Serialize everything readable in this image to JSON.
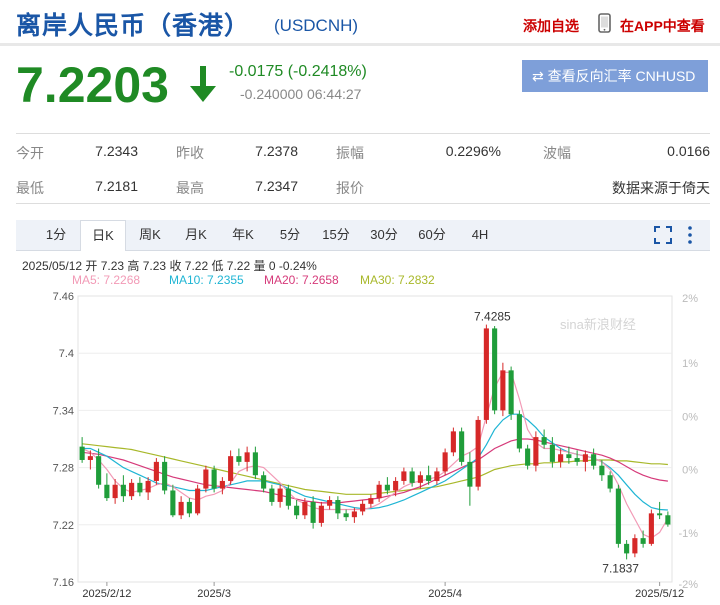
{
  "header": {
    "title": "离岸人民币（香港）",
    "symbol": "(USDCNH)",
    "add_watch": "添加自选",
    "app_link": "在APP中查看"
  },
  "quote": {
    "price": "7.2203",
    "change": "-0.0175 (-0.2418%)",
    "sub_change": "-0.240000 06:44:27",
    "reverse_button": "⇄ 查看反向汇率 CNHUSD"
  },
  "stats": {
    "row1": [
      {
        "label": "今开",
        "value": "7.2343"
      },
      {
        "label": "昨收",
        "value": "7.2378"
      },
      {
        "label": "振幅",
        "value": "0.2296%"
      },
      {
        "label": "波幅",
        "value": "0.0166"
      }
    ],
    "row2": [
      {
        "label": "最低",
        "value": "7.2181"
      },
      {
        "label": "最高",
        "value": "7.2347"
      },
      {
        "label": "报价",
        "value": "数据来源于倚天"
      }
    ]
  },
  "tabs": [
    "1分",
    "日K",
    "周K",
    "月K",
    "年K",
    "5分",
    "15分",
    "30分",
    "60分",
    "4H"
  ],
  "active_tab": "日K",
  "chart_info": {
    "line1": "2025/05/12 开 7.23 高 7.23 收 7.22 低 7.22 量 0 -0.24%",
    "ma5": "MA5: 7.2268",
    "ma10": "MA10: 7.2355",
    "ma20": "MA20: 7.2658",
    "ma30": "MA30: 7.2832"
  },
  "colors": {
    "up": "#d62828",
    "down": "#1f9d3a",
    "ma5": "#f29ab6",
    "ma10": "#1fb5d4",
    "ma20": "#d63a7a",
    "ma30": "#a8b82a"
  },
  "chart_data": {
    "type": "candlestick",
    "y_ticks": [
      "7.46",
      "7.4",
      "7.34",
      "7.28",
      "7.22",
      "7.16"
    ],
    "y_ticks_pct": [
      "2%",
      "1%",
      "0%",
      "0%",
      "-1%",
      "-2%"
    ],
    "x_ticks": [
      "2025/2/12",
      "2025/3",
      "2025/4",
      "2025/5/12"
    ],
    "annotations": [
      "7.4285",
      "7.1837"
    ],
    "watermark": "sina新浪财经",
    "ylim": [
      7.16,
      7.46
    ],
    "candles": [
      [
        7.302,
        7.312,
        7.285,
        7.288
      ],
      [
        7.288,
        7.298,
        7.278,
        7.292
      ],
      [
        7.292,
        7.3,
        7.258,
        7.262
      ],
      [
        7.262,
        7.274,
        7.245,
        7.248
      ],
      [
        7.248,
        7.268,
        7.242,
        7.262
      ],
      [
        7.262,
        7.272,
        7.244,
        7.25
      ],
      [
        7.25,
        7.268,
        7.246,
        7.264
      ],
      [
        7.264,
        7.27,
        7.25,
        7.254
      ],
      [
        7.254,
        7.27,
        7.246,
        7.266
      ],
      [
        7.266,
        7.29,
        7.262,
        7.286
      ],
      [
        7.286,
        7.292,
        7.252,
        7.256
      ],
      [
        7.256,
        7.262,
        7.228,
        7.23
      ],
      [
        7.23,
        7.25,
        7.226,
        7.244
      ],
      [
        7.244,
        7.248,
        7.228,
        7.232
      ],
      [
        7.232,
        7.262,
        7.23,
        7.258
      ],
      [
        7.258,
        7.282,
        7.254,
        7.278
      ],
      [
        7.278,
        7.282,
        7.254,
        7.258
      ],
      [
        7.258,
        7.27,
        7.252,
        7.266
      ],
      [
        7.266,
        7.298,
        7.262,
        7.292
      ],
      [
        7.292,
        7.3,
        7.282,
        7.286
      ],
      [
        7.286,
        7.302,
        7.276,
        7.296
      ],
      [
        7.296,
        7.302,
        7.268,
        7.272
      ],
      [
        7.272,
        7.276,
        7.254,
        7.258
      ],
      [
        7.258,
        7.262,
        7.24,
        7.244
      ],
      [
        7.244,
        7.262,
        7.238,
        7.258
      ],
      [
        7.258,
        7.262,
        7.236,
        7.24
      ],
      [
        7.24,
        7.246,
        7.226,
        7.23
      ],
      [
        7.23,
        7.248,
        7.226,
        7.244
      ],
      [
        7.244,
        7.25,
        7.216,
        7.222
      ],
      [
        7.222,
        7.244,
        7.218,
        7.24
      ],
      [
        7.24,
        7.25,
        7.236,
        7.246
      ],
      [
        7.246,
        7.25,
        7.226,
        7.232
      ],
      [
        7.232,
        7.236,
        7.224,
        7.228
      ],
      [
        7.228,
        7.238,
        7.222,
        7.234
      ],
      [
        7.234,
        7.246,
        7.23,
        7.242
      ],
      [
        7.242,
        7.252,
        7.238,
        7.248
      ],
      [
        7.248,
        7.266,
        7.244,
        7.262
      ],
      [
        7.262,
        7.27,
        7.252,
        7.256
      ],
      [
        7.256,
        7.27,
        7.25,
        7.266
      ],
      [
        7.266,
        7.28,
        7.262,
        7.276
      ],
      [
        7.276,
        7.28,
        7.26,
        7.264
      ],
      [
        7.264,
        7.276,
        7.258,
        7.272
      ],
      [
        7.272,
        7.282,
        7.262,
        7.266
      ],
      [
        7.266,
        7.28,
        7.262,
        7.276
      ],
      [
        7.276,
        7.3,
        7.272,
        7.296
      ],
      [
        7.296,
        7.322,
        7.292,
        7.318
      ],
      [
        7.318,
        7.322,
        7.282,
        7.286
      ],
      [
        7.286,
        7.296,
        7.24,
        7.26
      ],
      [
        7.26,
        7.334,
        7.256,
        7.33
      ],
      [
        7.33,
        7.43,
        7.326,
        7.426
      ],
      [
        7.426,
        7.4285,
        7.336,
        7.34
      ],
      [
        7.34,
        7.39,
        7.334,
        7.382
      ],
      [
        7.382,
        7.386,
        7.33,
        7.336
      ],
      [
        7.336,
        7.34,
        7.296,
        7.3
      ],
      [
        7.3,
        7.304,
        7.278,
        7.282
      ],
      [
        7.282,
        7.318,
        7.276,
        7.312
      ],
      [
        7.312,
        7.32,
        7.3,
        7.304
      ],
      [
        7.304,
        7.312,
        7.28,
        7.286
      ],
      [
        7.286,
        7.3,
        7.28,
        7.294
      ],
      [
        7.294,
        7.302,
        7.284,
        7.29
      ],
      [
        7.29,
        7.298,
        7.282,
        7.286
      ],
      [
        7.286,
        7.298,
        7.276,
        7.294
      ],
      [
        7.294,
        7.3,
        7.278,
        7.282
      ],
      [
        7.282,
        7.288,
        7.266,
        7.272
      ],
      [
        7.272,
        7.276,
        7.254,
        7.258
      ],
      [
        7.258,
        7.262,
        7.196,
        7.2
      ],
      [
        7.2,
        7.204,
        7.1837,
        7.19
      ],
      [
        7.19,
        7.21,
        7.186,
        7.206
      ],
      [
        7.206,
        7.214,
        7.196,
        7.2
      ],
      [
        7.2,
        7.236,
        7.198,
        7.232
      ],
      [
        7.232,
        7.244,
        7.226,
        7.23
      ],
      [
        7.23,
        7.234,
        7.218,
        7.2203
      ]
    ],
    "ma5": [
      7.3,
      7.296,
      7.288,
      7.278,
      7.266,
      7.258,
      7.254,
      7.256,
      7.258,
      7.262,
      7.264,
      7.26,
      7.254,
      7.248,
      7.246,
      7.25,
      7.252,
      7.256,
      7.264,
      7.276,
      7.28,
      7.282,
      7.28,
      7.272,
      7.264,
      7.254,
      7.246,
      7.242,
      7.238,
      7.236,
      7.236,
      7.236,
      7.236,
      7.236,
      7.236,
      7.238,
      7.242,
      7.248,
      7.254,
      7.26,
      7.264,
      7.266,
      7.268,
      7.27,
      7.276,
      7.284,
      7.292,
      7.296,
      7.302,
      7.334,
      7.364,
      7.38,
      7.38,
      7.352,
      7.32,
      7.306,
      7.3,
      7.3,
      7.298,
      7.296,
      7.294,
      7.292,
      7.29,
      7.286,
      7.278,
      7.262,
      7.242,
      7.226,
      7.21,
      7.206,
      7.212,
      7.2268
    ],
    "ma10": [
      7.3,
      7.3,
      7.296,
      7.292,
      7.286,
      7.28,
      7.276,
      7.272,
      7.268,
      7.264,
      7.262,
      7.26,
      7.258,
      7.256,
      7.256,
      7.256,
      7.258,
      7.26,
      7.262,
      7.264,
      7.266,
      7.266,
      7.266,
      7.264,
      7.262,
      7.258,
      7.254,
      7.25,
      7.248,
      7.246,
      7.244,
      7.242,
      7.24,
      7.238,
      7.237,
      7.237,
      7.238,
      7.24,
      7.243,
      7.246,
      7.25,
      7.254,
      7.258,
      7.262,
      7.266,
      7.272,
      7.278,
      7.284,
      7.29,
      7.304,
      7.32,
      7.33,
      7.336,
      7.336,
      7.33,
      7.322,
      7.312,
      7.306,
      7.3,
      7.296,
      7.294,
      7.292,
      7.29,
      7.286,
      7.28,
      7.272,
      7.262,
      7.252,
      7.244,
      7.238,
      7.236,
      7.2355
    ],
    "ma20": [
      7.296,
      7.295,
      7.294,
      7.292,
      7.29,
      7.288,
      7.285,
      7.282,
      7.279,
      7.276,
      7.273,
      7.27,
      7.268,
      7.266,
      7.264,
      7.262,
      7.261,
      7.26,
      7.259,
      7.258,
      7.257,
      7.256,
      7.255,
      7.253,
      7.251,
      7.249,
      7.247,
      7.245,
      7.244,
      7.243,
      7.243,
      7.243,
      7.244,
      7.245,
      7.246,
      7.247,
      7.248,
      7.25,
      7.252,
      7.254,
      7.257,
      7.26,
      7.264,
      7.268,
      7.272,
      7.276,
      7.28,
      7.284,
      7.288,
      7.294,
      7.3,
      7.304,
      7.308,
      7.31,
      7.31,
      7.309,
      7.307,
      7.305,
      7.303,
      7.301,
      7.299,
      7.297,
      7.295,
      7.293,
      7.29,
      7.286,
      7.281,
      7.276,
      7.272,
      7.269,
      7.267,
      7.2658
    ],
    "ma30": [
      7.305,
      7.304,
      7.303,
      7.302,
      7.301,
      7.3,
      7.299,
      7.297,
      7.295,
      7.293,
      7.291,
      7.289,
      7.287,
      7.285,
      7.283,
      7.281,
      7.279,
      7.277,
      7.275,
      7.273,
      7.271,
      7.269,
      7.267,
      7.265,
      7.263,
      7.261,
      7.259,
      7.257,
      7.256,
      7.255,
      7.254,
      7.253,
      7.252,
      7.252,
      7.252,
      7.252,
      7.253,
      7.254,
      7.255,
      7.256,
      7.257,
      7.258,
      7.259,
      7.26,
      7.262,
      7.264,
      7.266,
      7.268,
      7.27,
      7.274,
      7.278,
      7.28,
      7.282,
      7.283,
      7.284,
      7.284,
      7.285,
      7.285,
      7.286,
      7.286,
      7.287,
      7.287,
      7.288,
      7.288,
      7.288,
      7.287,
      7.287,
      7.286,
      7.285,
      7.284,
      7.284,
      7.2832
    ]
  }
}
